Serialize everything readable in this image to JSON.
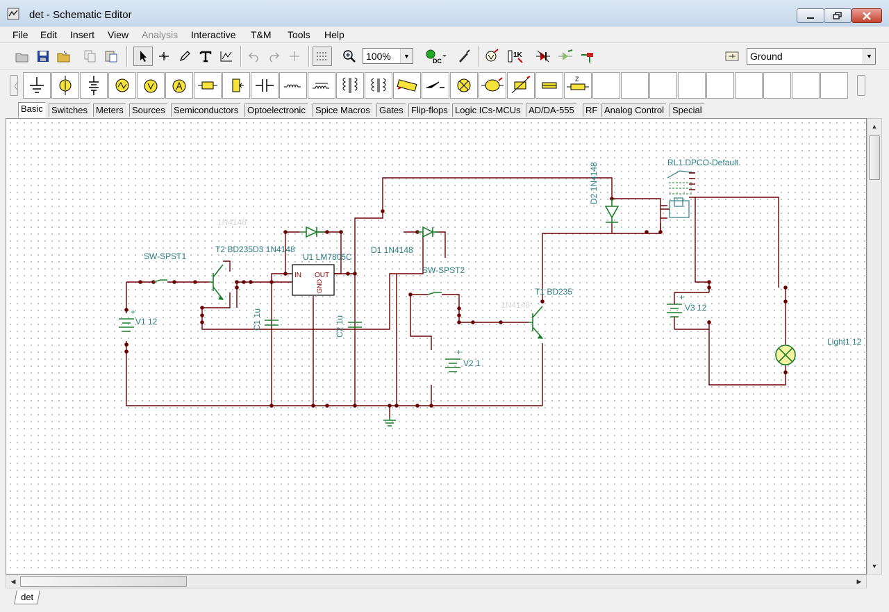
{
  "window": {
    "title": "det - Schematic Editor"
  },
  "menu": [
    "File",
    "Edit",
    "Insert",
    "View",
    "Analysis",
    "Interactive",
    "T&M",
    "Tools",
    "Help"
  ],
  "toolbar": {
    "zoom": "100%",
    "dc_label": "DC",
    "ohm_label": "1K",
    "ground_select": "Ground"
  },
  "component_tabs": [
    "Basic",
    "Switches",
    "Meters",
    "Sources",
    "Semiconductors",
    "Optoelectronic",
    "Spice Macros",
    "Gates",
    "Flip-flops",
    "Logic ICs-MCUs",
    "AD/DA-555",
    "RF",
    "Analog Control",
    "Special"
  ],
  "active_component_tab": "Basic",
  "schematic": {
    "labels": {
      "sw1": "SW-SPST1",
      "t2": "T2 BD235",
      "d3": "D3 1N4148",
      "u1": "U1 LM7805C",
      "u1_in": "IN",
      "u1_out": "OUT",
      "u1_gnd": "GND",
      "d1": "D1 1N4148",
      "sw2": "SW-SPST2",
      "t1": "T1 BD235",
      "c1": "C1 1u",
      "c2": "C2 1u",
      "v1": "V1 12",
      "v2": "V2 1",
      "v3": "V3 12",
      "d2": "D2 1N4148",
      "rl1": "RL1 DPCO-Default",
      "light1": "Light1 12",
      "plus": "+"
    },
    "wire_color": "#6b0000",
    "label_color": "#2e7f86",
    "component_color": "#1a7f2a"
  },
  "sheet_tab": "det"
}
